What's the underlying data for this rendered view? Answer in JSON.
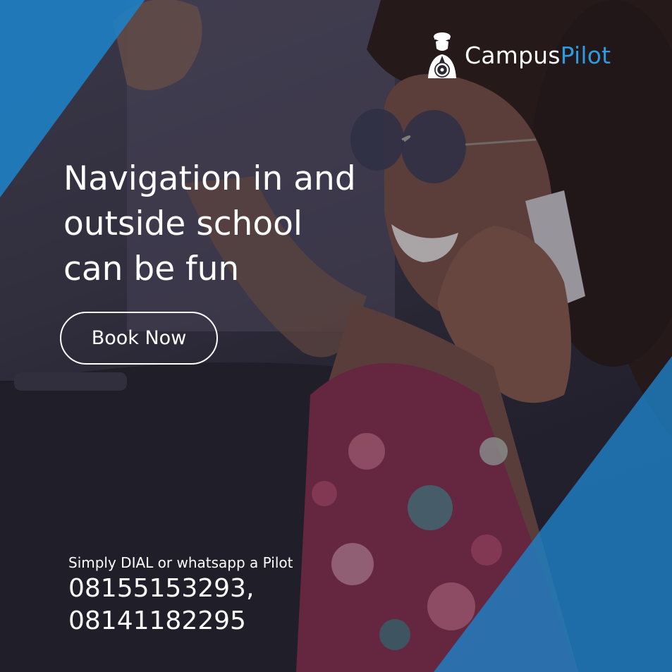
{
  "brand": {
    "name_part1": "Campus",
    "name_part2": "Pilot",
    "accent_color": "#2f9ae0",
    "icon": "chauffeur-steering-wheel-icon"
  },
  "hero": {
    "headline_lines": [
      "Navigation in and",
      "outside school",
      "can be fun"
    ],
    "cta_label": "Book Now"
  },
  "contact": {
    "intro": "Simply DIAL or whatsapp a Pilot",
    "phones": [
      "08155153293,",
      "08141182295"
    ]
  },
  "colors": {
    "accent_blue": "#1f7fc4",
    "text": "#ffffff"
  }
}
